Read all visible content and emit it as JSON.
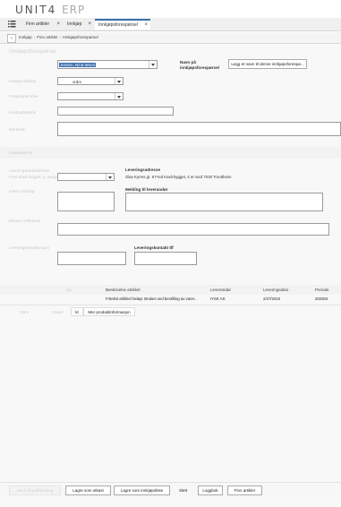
{
  "app": {
    "logo_brand": "UNIT4",
    "logo_product": "ERP"
  },
  "tabs": [
    {
      "label": "Finn artikler",
      "close": "×"
    },
    {
      "label": "Innkjøp",
      "close": "×"
    },
    {
      "label": "Innkjøpsforespørsel",
      "close": "×"
    }
  ],
  "breadcrumb": {
    "items": [
      "Innkjøp",
      "Finn artikler",
      "Innkjøpsforespørsel"
    ],
    "separator": "›",
    "back": "‹"
  },
  "form": {
    "ghost_title": "Innkjøpsforespørsel",
    "requester_value": "Jensen, Nina Worsi",
    "name_label": "Navn på innkjøpsforespørsel",
    "name_placeholder": "Legg et navn til denne innkjøpsforespø...",
    "ghost_label_1": "Kategori/valuta",
    "ghost_label_2": "Prosjektnummer",
    "ghost_label_3": "Kostnadsbærer",
    "ghost_label_4": "Merknad",
    "select_1_value": "ordre",
    "ghost_section": "Leveranse til",
    "ghost_label_5": "Leveringssted/adresse",
    "ghost_label_6": "Fred Kavli-bygget, 4. etasje",
    "delivery_address_label": "Leveringsadresse",
    "delivery_address_value": "Olav Kyrres gt. 9 Fred Kavli-bygget, 4 et nord 7030 Trondheim",
    "ghost_label_7": "Intern melding",
    "supplier_message_label": "Melding til leverandør",
    "ghost_label_8": "Ekstern referanse",
    "ghost_label_9": "Leveringskontakt navn",
    "delivery_contact_label": "Leveringskontakt tlf"
  },
  "grid": {
    "headers": [
      "Beskrivelse artikkel",
      "Leverandør",
      "Leveringsdato",
      "Periode"
    ],
    "ghost_header": "EL",
    "rows": [
      {
        "description": "Fritekst artikkel beløp: Brukes ved bestilling av varer...",
        "supplier": "IYSK AS",
        "date": "2/27/2022",
        "period": "202302"
      }
    ],
    "action_1": "kt",
    "action_2": "Mer produktinformasjon",
    "ghost_action_1": "Fjern",
    "ghost_action_2": "Kopier"
  },
  "footer": {
    "ghost_button": "Send til godkjenning",
    "save_draft": "Lagre som utkast",
    "save_purchase_list": "Lagre som innkjøpsliste",
    "delete": "Slett",
    "logbook": "Loggbok",
    "find_articles": "Finn artikler"
  }
}
